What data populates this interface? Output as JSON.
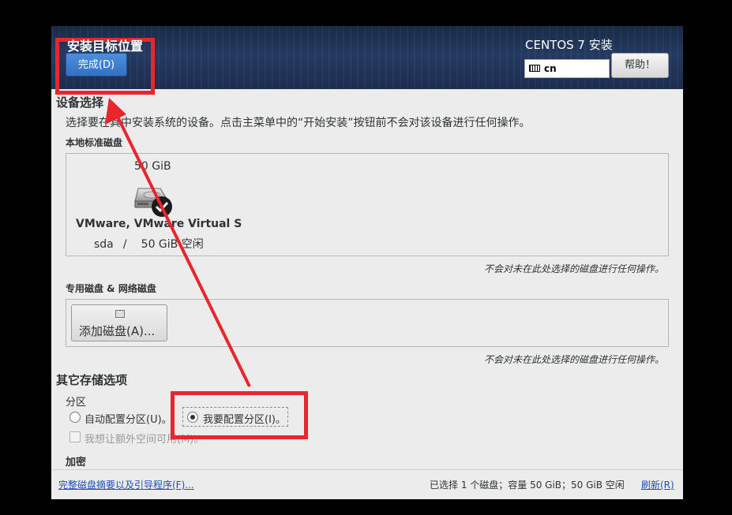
{
  "header": {
    "spoke_title": "安装目标位置",
    "done_label": "完成(D)",
    "product_title": "CENTOS 7 安装",
    "keyboard_layout": "cn",
    "help_label": "帮助！"
  },
  "device_selection": {
    "title": "设备选择",
    "description": "选择要在其中安装系统的设备。点击主菜单中的“开始安装”按钮前不会对该设备进行任何操作。",
    "local_disks_label": "本地标准磁盘",
    "disk": {
      "size": "50 GiB",
      "name": "VMware, VMware Virtual S",
      "device": "sda",
      "separator": "/",
      "free": "50 GiB 空闲",
      "selected": true
    },
    "local_note": "不会对未在此处选择的磁盘进行任何操作。",
    "specialized_label": "专用磁盘 & 网络磁盘",
    "add_disk_label": "添加磁盘(A)...",
    "specialized_note": "不会对未在此处选择的磁盘进行任何操作。"
  },
  "other_storage": {
    "title": "其它存储选项",
    "partition_label": "分区",
    "auto_label": "自动配置分区(U)。",
    "manual_label": "我要配置分区(I)。",
    "manual_selected": true,
    "extra_space_label": "我想让额外空间可用(M)。",
    "encryption_label": "加密"
  },
  "footer": {
    "summary_link": "完整磁盘摘要以及引导程序(F)...",
    "status": "已选择 1 个磁盘；容量 50 GiB；50 GiB 空闲",
    "refresh_link": "刷新(R)"
  },
  "colors": {
    "annotation_red": "#e8262b",
    "done_button_blue": "#3d7fd0",
    "header_navy": "#1f3152",
    "link_blue": "#1f4fb5"
  }
}
